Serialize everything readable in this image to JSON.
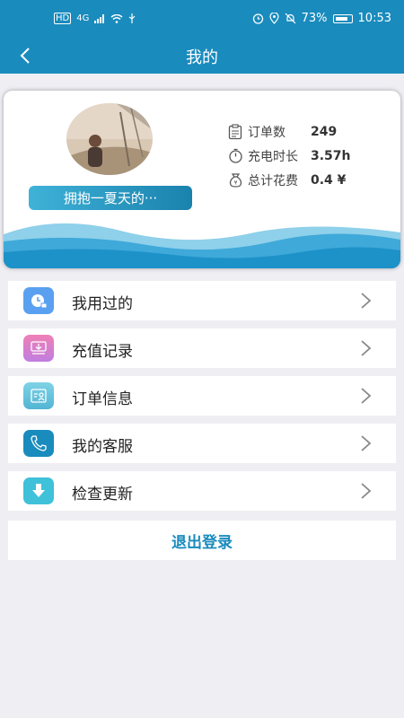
{
  "status": {
    "left_labels": [
      "HD",
      "4G"
    ],
    "battery": "73%",
    "time": "10:53"
  },
  "nav": {
    "title": "我的"
  },
  "profile": {
    "username": "拥抱一夏天的···",
    "stats": [
      {
        "icon": "clipboard-icon",
        "label": "订单数",
        "value": "249"
      },
      {
        "icon": "stopwatch-icon",
        "label": "充电时长",
        "value": "3.57h"
      },
      {
        "icon": "money-bag-icon",
        "label": "总计花费",
        "value": "0.4 ¥"
      }
    ]
  },
  "menu": [
    {
      "icon": "clock-icon",
      "label": "我用过的",
      "color": "#5aa0f0"
    },
    {
      "icon": "recharge-icon",
      "label": "充值记录",
      "color": "#e27bd0"
    },
    {
      "icon": "order-info-icon",
      "label": "订单信息",
      "color": "#5fc1d8"
    },
    {
      "icon": "phone-icon",
      "label": "我的客服",
      "color": "#1a8bbd"
    },
    {
      "icon": "download-icon",
      "label": "检查更新",
      "color": "#3ec1d9"
    }
  ],
  "logout_label": "退出登录",
  "colors": {
    "primary": "#1a8bbd",
    "background": "#efeef3"
  }
}
